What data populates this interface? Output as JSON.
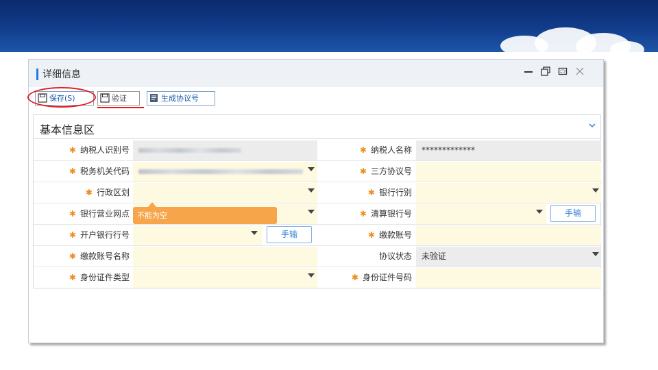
{
  "dialog": {
    "title": "详细信息",
    "window_controls": [
      "minimize-icon",
      "restore-icon",
      "maximize-icon",
      "close-icon"
    ]
  },
  "toolbar": {
    "save_label": "保存(S)",
    "verify_label": "验证",
    "generate_label": "生成协议号"
  },
  "panel": {
    "title": "基本信息区",
    "toggle_icon": "chevron-down-icon"
  },
  "form": {
    "taxpayer_id_label": "纳税人识别号",
    "taxpayer_name_label": "纳税人名称",
    "taxpayer_name_value": "*************",
    "tax_office_code_label": "税务机关代码",
    "tripartite_no_label": "三方协议号",
    "admin_region_label": "行政区划",
    "bank_type_label": "银行行别",
    "bank_branch_label": "银行营业网点",
    "clearing_bank_label": "清算银行号",
    "manual_label": "手输",
    "opening_bank_label": "开户银行行号",
    "payment_account_label": "缴款账号",
    "account_name_label": "缴款账号名称",
    "agreement_status_label": "协议状态",
    "agreement_status_value": "未验证",
    "id_type_label": "身份证件类型",
    "id_number_label": "身份证件号码",
    "validation_tip": "不能为空"
  },
  "colors": {
    "accent": "#1e7be0",
    "required_star": "#f08c1e",
    "required_field": "#fef9e1",
    "tooltip": "#f7a54a",
    "annotation": "#e51b1b"
  }
}
